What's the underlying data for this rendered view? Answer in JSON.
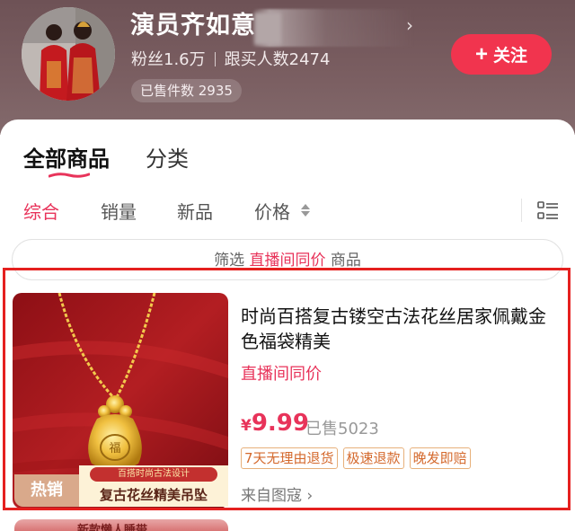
{
  "shop": {
    "name": "演员齐如意",
    "fans": "粉丝1.6万",
    "buyers": "跟买人数2474",
    "sold_count": "已售件数 2935",
    "follow_label": "关注",
    "header_trailing_glyph": "›"
  },
  "tabs": [
    {
      "label": "全部商品",
      "active": true
    },
    {
      "label": "分类",
      "active": false
    }
  ],
  "sort": {
    "items": [
      {
        "label": "综合",
        "active": true
      },
      {
        "label": "销量",
        "active": false
      },
      {
        "label": "新品",
        "active": false
      },
      {
        "label": "价格",
        "active": false
      }
    ]
  },
  "filter": {
    "prefix": "筛选",
    "highlight": "直播间同价",
    "suffix": "商品"
  },
  "product": {
    "title": "时尚百搭复古镂空古法花丝居家佩戴金色福袋精美",
    "tag": "直播间同价",
    "currency": "¥",
    "price": "9.99",
    "sold": "已售5023",
    "perks": [
      "7天无理由退货",
      "极速退款",
      "晚发即赔"
    ],
    "source": "来自图寇 ›",
    "badge_hot": "热销",
    "badge_subtitle": "百搭时尚古法设计",
    "badge_title": "复古花丝精美吊坠"
  },
  "next_product_peek": "新款懒人睡带",
  "colors": {
    "accent": "#e8335a",
    "follow": "#f1344e",
    "highlight_box": "#e5201f",
    "header_bg": "#7b5f62"
  },
  "icons": {
    "list_toggle": "list-view-icon",
    "sort_price": "sort-updown-icon"
  }
}
